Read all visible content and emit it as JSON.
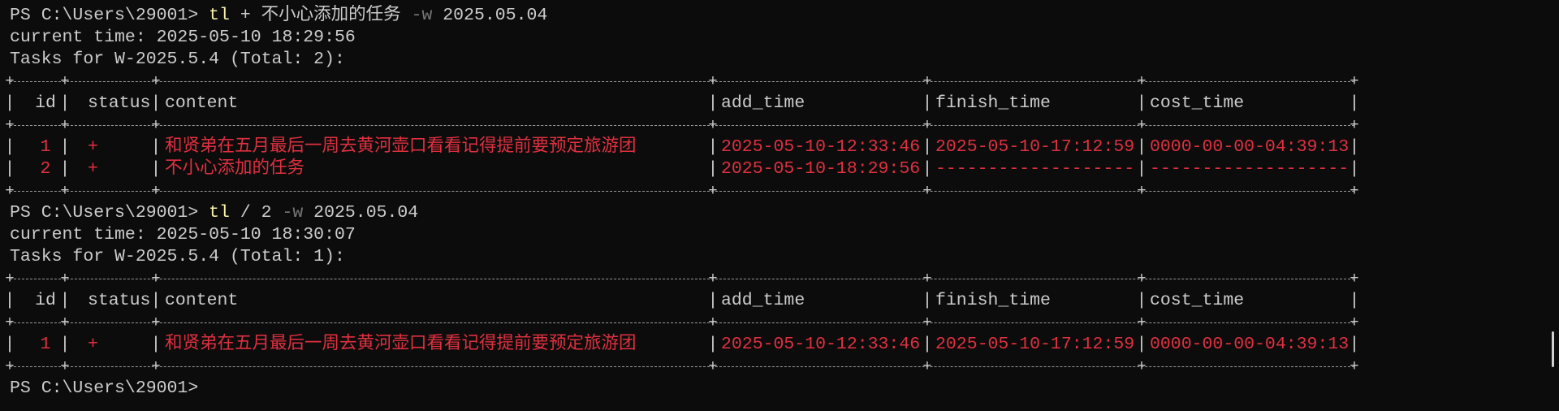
{
  "blocks": [
    {
      "prompt": "PS C:\\Users\\29001> ",
      "cmd": "tl",
      "args": " + 不小心添加的任务 ",
      "flag": "-w",
      "flag_value": " 2025.05.04",
      "current_time": "current time: 2025-05-10 18:29:56",
      "tasks_header": "Tasks for W-2025.5.4 (Total: 2):",
      "rows": [
        {
          "id": "1",
          "status": "+",
          "content": "和贤弟在五月最后一周去黄河壶口看看记得提前要预定旅游团",
          "add_time": "2025-05-10-12:33:46",
          "finish_time": "2025-05-10-17:12:59",
          "cost_time": "0000-00-00-04:39:13"
        },
        {
          "id": "2",
          "status": "+",
          "content": "不小心添加的任务",
          "add_time": "2025-05-10-18:29:56",
          "finish_time": "-------------------",
          "cost_time": "-------------------"
        }
      ]
    },
    {
      "prompt": "PS C:\\Users\\29001> ",
      "cmd": "tl",
      "args": " / 2 ",
      "flag": "-w",
      "flag_value": " 2025.05.04",
      "current_time": "current time: 2025-05-10 18:30:07",
      "tasks_header": "Tasks for W-2025.5.4 (Total: 1):",
      "rows": [
        {
          "id": "1",
          "status": "+",
          "content": "和贤弟在五月最后一周去黄河壶口看看记得提前要预定旅游团",
          "add_time": "2025-05-10-12:33:46",
          "finish_time": "2025-05-10-17:12:59",
          "cost_time": "0000-00-00-04:39:13"
        }
      ]
    }
  ],
  "table_headers": {
    "id": "id",
    "status": "status",
    "content": "content",
    "add_time": "add_time",
    "finish_time": "finish_time",
    "cost_time": "cost_time"
  },
  "final_prompt": "PS C:\\Users\\29001>",
  "colors": {
    "background": "#0c0c0c",
    "text": "#cccccc",
    "command": "#f9f1a5",
    "flag": "#767676",
    "task_red": "#e0303f"
  }
}
